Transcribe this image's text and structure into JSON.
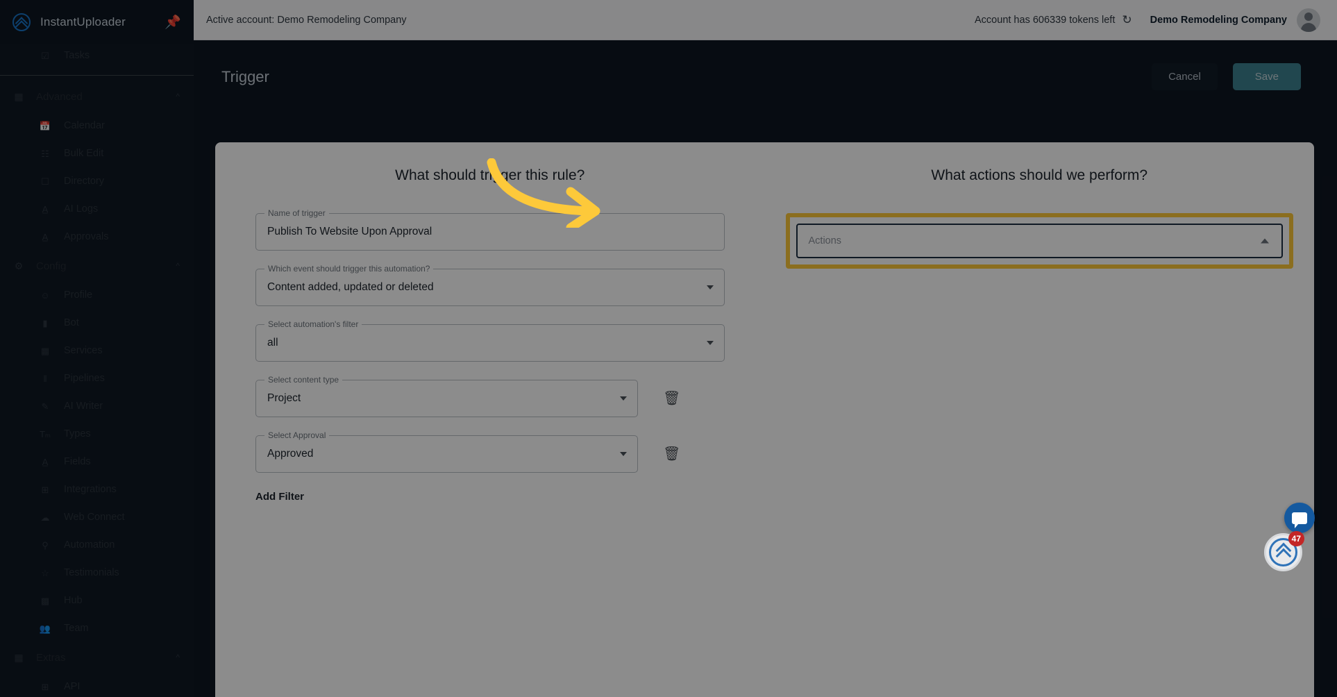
{
  "sidebar": {
    "brand": "InstantUploader",
    "pin_icon": "pin-icon",
    "top_items": [
      {
        "label": "Tasks",
        "icon": "checkbox-icon"
      }
    ],
    "groups": [
      {
        "label": "Advanced",
        "icon": "grid-icon",
        "chevron": "chevron-up-icon",
        "items": [
          {
            "label": "Calendar",
            "icon": "calendar-icon"
          },
          {
            "label": "Bulk Edit",
            "icon": "list-icon"
          },
          {
            "label": "Directory",
            "icon": "contact-card-icon"
          },
          {
            "label": "AI Logs",
            "icon": "text-icon"
          },
          {
            "label": "Approvals",
            "icon": "text-icon"
          }
        ]
      },
      {
        "label": "Config",
        "icon": "gear-icon",
        "chevron": "chevron-up-icon",
        "items": [
          {
            "label": "Profile",
            "icon": "person-icon"
          },
          {
            "label": "Bot",
            "icon": "message-icon"
          },
          {
            "label": "Services",
            "icon": "building-icon"
          },
          {
            "label": "Pipelines",
            "icon": "columns-icon"
          },
          {
            "label": "AI Writer",
            "icon": "pencil-icon"
          },
          {
            "label": "Types",
            "icon": "text-format-icon"
          },
          {
            "label": "Fields",
            "icon": "text-icon"
          },
          {
            "label": "Integrations",
            "icon": "plus-box-icon"
          },
          {
            "label": "Web Connect",
            "icon": "cloud-icon"
          },
          {
            "label": "Automation",
            "icon": "bell-icon"
          },
          {
            "label": "Testimonials",
            "icon": "star-icon"
          },
          {
            "label": "Hub",
            "icon": "card-icon"
          },
          {
            "label": "Team",
            "icon": "people-icon"
          }
        ]
      },
      {
        "label": "Extras",
        "icon": "grid-icon",
        "chevron": "chevron-up-icon",
        "items": [
          {
            "label": "API",
            "icon": "plus-box-icon"
          }
        ]
      }
    ]
  },
  "topbar": {
    "active_account": "Active account: Demo Remodeling Company",
    "tokens": "Account has 606339 tokens left",
    "refresh_icon": "refresh-icon",
    "account_name": "Demo Remodeling Company",
    "avatar": "avatar"
  },
  "pagebar": {
    "title": "Trigger",
    "cancel_label": "Cancel",
    "save_label": "Save"
  },
  "trigger_panel": {
    "heading": "What should trigger this rule?",
    "fields": [
      {
        "legend": "Name of trigger",
        "value": "Publish To Website Upon Approval",
        "type": "text"
      },
      {
        "legend": "Which event should trigger this automation?",
        "value": "Content added, updated or deleted",
        "type": "select"
      },
      {
        "legend": "Select automation's filter",
        "value": "all",
        "type": "select"
      },
      {
        "legend": "Select content type",
        "value": "Project",
        "type": "select",
        "deletable": true
      },
      {
        "legend": "Select Approval",
        "value": "Approved",
        "type": "select",
        "deletable": true
      }
    ],
    "add_filter_label": "Add Filter",
    "delete_icon": "trash-icon"
  },
  "actions_panel": {
    "heading": "What actions should we perform?",
    "select_placeholder": "Actions",
    "caret_icon": "chevron-up-icon",
    "highlight_color": "#fdc93a"
  },
  "widgets": {
    "chat_icon": "chat-bubble-icon",
    "scroll_top_icon": "double-chevron-up-icon",
    "badge_count": "47"
  },
  "colors": {
    "app_bg": "#0e1621",
    "sidebar_bg": "#0f1823",
    "save_button": "#3d8190",
    "highlight": "#fdc93a",
    "arrow": "#fdc93a",
    "badge": "#c32626",
    "chat": "#14599f"
  }
}
